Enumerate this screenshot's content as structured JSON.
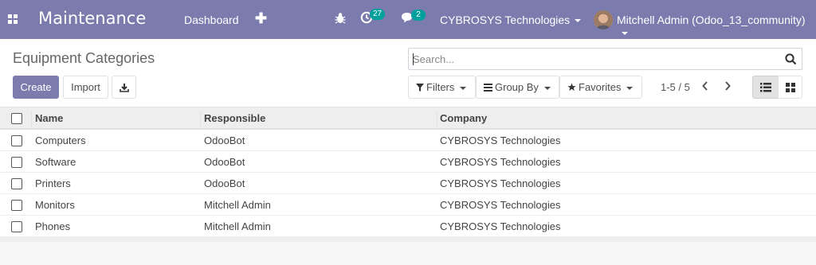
{
  "navbar": {
    "app_name": "Maintenance",
    "menu_dashboard": "Dashboard",
    "activity_count": "27",
    "message_count": "2",
    "company": "CYBROSYS Technologies",
    "user": "Mitchell Admin (Odoo_13_community)",
    "bg_color": "#7c7bad"
  },
  "control": {
    "breadcrumb": "Equipment Categories",
    "search_value": "Search...",
    "create_label": "Create",
    "import_label": "Import",
    "filters_label": "Filters",
    "group_by_label": "Group By",
    "favorites_label": "Favorites",
    "pager": "1-5 / 5"
  },
  "table": {
    "headers": {
      "name": "Name",
      "responsible": "Responsible",
      "company": "Company"
    },
    "rows": [
      {
        "name": "Computers",
        "responsible": "OdooBot",
        "company": "CYBROSYS Technologies"
      },
      {
        "name": "Software",
        "responsible": "OdooBot",
        "company": "CYBROSYS Technologies"
      },
      {
        "name": "Printers",
        "responsible": "OdooBot",
        "company": "CYBROSYS Technologies"
      },
      {
        "name": "Monitors",
        "responsible": "Mitchell Admin",
        "company": "CYBROSYS Technologies"
      },
      {
        "name": "Phones",
        "responsible": "Mitchell Admin",
        "company": "CYBROSYS Technologies"
      }
    ]
  },
  "icons": {
    "apps": "apps-grid-icon",
    "plus": "plus-icon",
    "bug": "bug-icon",
    "activity": "activity-clock-icon",
    "chat": "chat-icon",
    "search": "search-icon",
    "download": "download-icon",
    "filter": "filter-icon",
    "group": "group-by-icon",
    "star": "star-icon",
    "list": "list-view-icon",
    "kanban": "kanban-view-icon"
  }
}
